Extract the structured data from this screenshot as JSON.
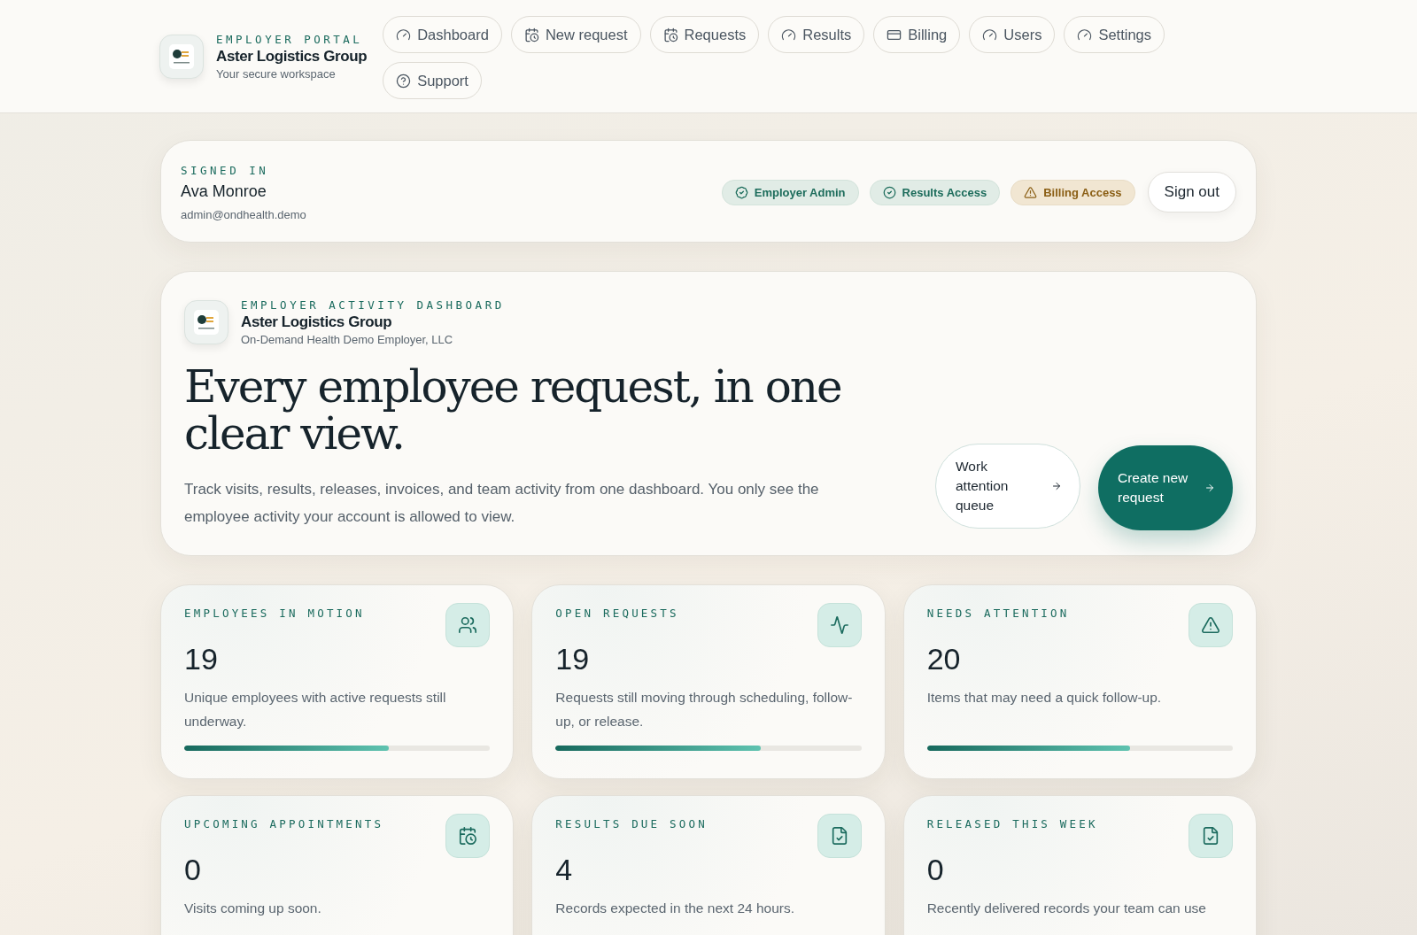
{
  "header": {
    "eyebrow": "EMPLOYER PORTAL",
    "org": "Aster Logistics Group",
    "subtitle": "Your secure workspace",
    "nav": [
      {
        "label": "Dashboard",
        "selected": false
      },
      {
        "label": "New request",
        "selected": false
      },
      {
        "label": "Requests",
        "selected": false
      },
      {
        "label": "Results",
        "selected": false
      },
      {
        "label": "Billing",
        "selected": false
      },
      {
        "label": "Users",
        "selected": false
      },
      {
        "label": "Settings",
        "selected": false
      },
      {
        "label": "Support",
        "selected": false
      }
    ]
  },
  "session": {
    "eyebrow": "SIGNED IN",
    "name": "Ava Monroe",
    "email": "admin@ondhealth.demo",
    "badges": [
      {
        "label": "Employer Admin",
        "kind": "ok"
      },
      {
        "label": "Results Access",
        "kind": "ok"
      },
      {
        "label": "Billing Access",
        "kind": "warn"
      }
    ],
    "sign_out": "Sign out"
  },
  "hero": {
    "eyebrow": "EMPLOYER ACTIVITY DASHBOARD",
    "org": "Aster Logistics Group",
    "legal_name": "On-Demand Health Demo Employer, LLC",
    "headline": "Every employee request, in one clear view.",
    "body": "Track visits, results, releases, invoices, and team activity from one dashboard. You only see the employee activity your account is allowed to view.",
    "secondary_action": "Work attention queue",
    "primary_action": "Create new request"
  },
  "stats": [
    {
      "label": "EMPLOYEES IN MOTION",
      "value": "19",
      "note": "Unique employees with active requests still underway.",
      "level": 0.67
    },
    {
      "label": "OPEN REQUESTS",
      "value": "19",
      "note": "Requests still moving through scheduling, follow-up, or release.",
      "level": 0.67
    },
    {
      "label": "NEEDS ATTENTION",
      "value": "20",
      "note": "Items that may need a quick follow-up.",
      "level": 0.665
    },
    {
      "label": "UPCOMING APPOINTMENTS",
      "value": "0",
      "note": "Visits coming up soon."
    },
    {
      "label": "RESULTS DUE SOON",
      "value": "4",
      "note": "Records expected in the next 24 hours."
    },
    {
      "label": "RELEASED THIS WEEK",
      "value": "0",
      "note": "Recently delivered records your team can use"
    }
  ]
}
